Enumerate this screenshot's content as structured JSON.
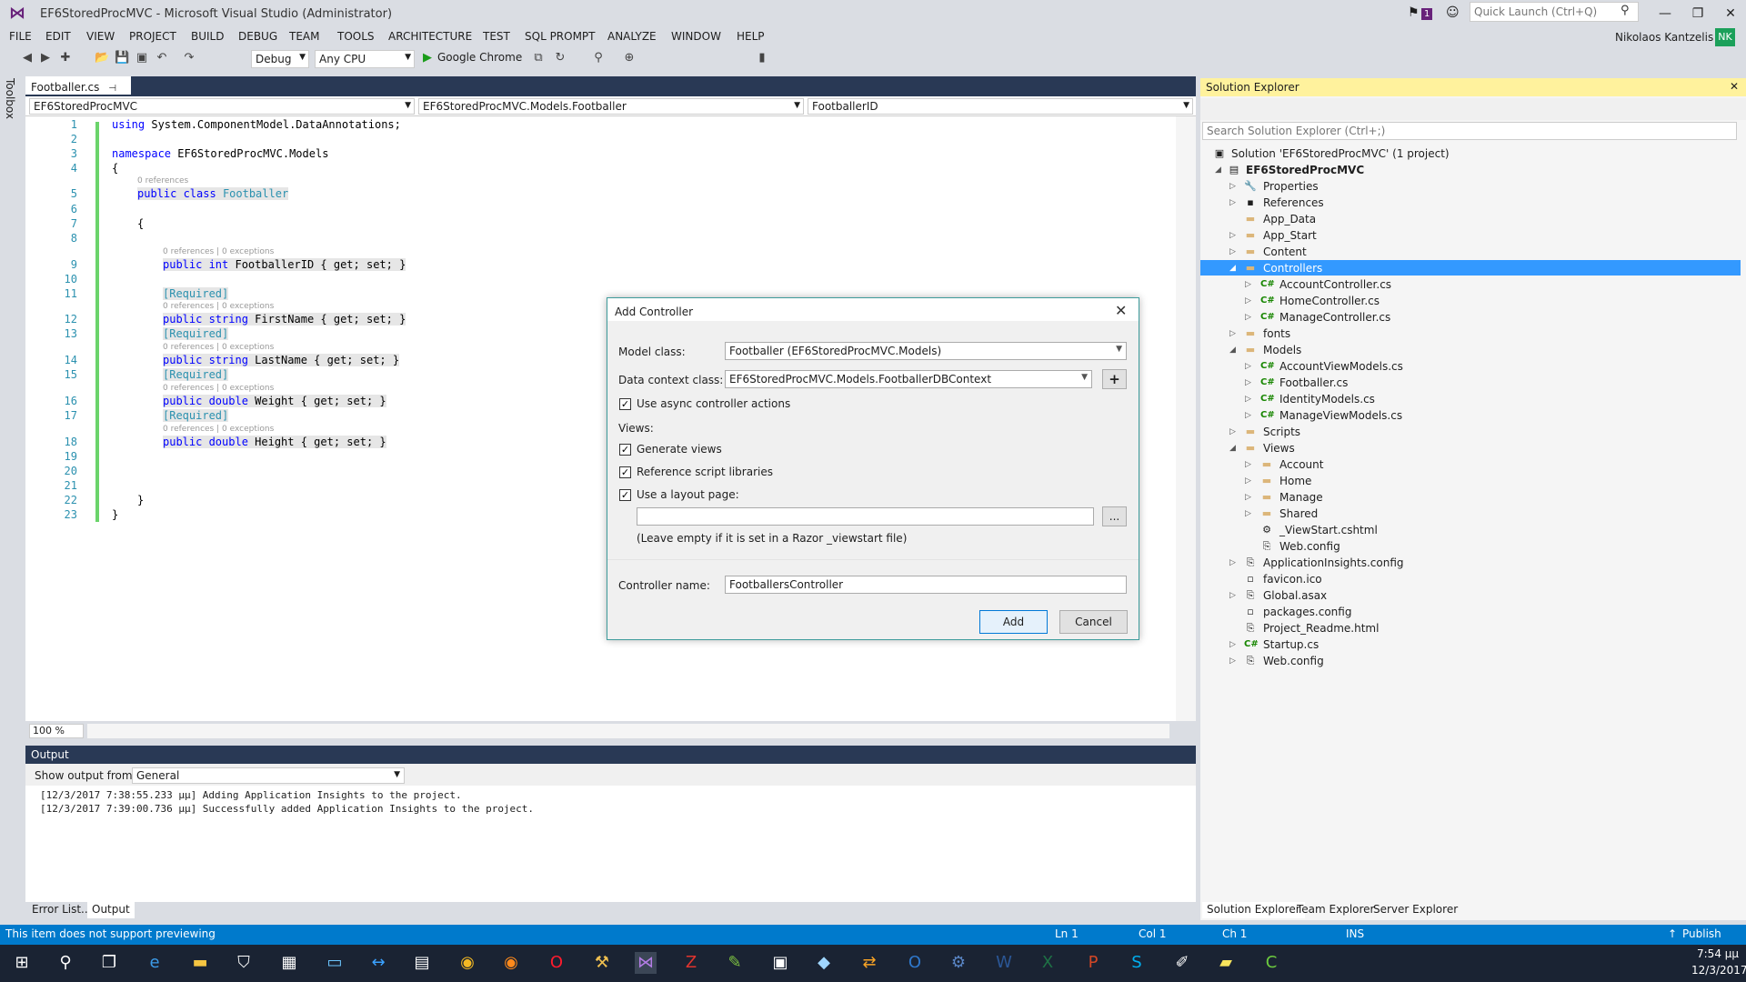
{
  "window": {
    "title": "EF6StoredProcMVC - Microsoft Visual Studio (Administrator)",
    "notification_count": "1",
    "quick_launch_placeholder": "Quick Launch (Ctrl+Q)",
    "user": "Nikolaos Kantzelis",
    "user_initials": "NK"
  },
  "menu": [
    "FILE",
    "EDIT",
    "VIEW",
    "PROJECT",
    "BUILD",
    "DEBUG",
    "TEAM",
    "TOOLS",
    "ARCHITECTURE",
    "TEST",
    "SQL PROMPT",
    "ANALYZE",
    "WINDOW",
    "HELP"
  ],
  "toolbar": {
    "config": "Debug",
    "platform": "Any CPU",
    "browser": "Google Chrome"
  },
  "toolbox": {
    "label": "Toolbox"
  },
  "editor": {
    "tab": "Footballer.cs",
    "nav_project": "EF6StoredProcMVC",
    "nav_class": "EF6StoredProcMVC.Models.Footballer",
    "nav_member": "FootballerID",
    "zoom": "100 %",
    "line_numbers": [
      "1",
      "2",
      "3",
      "4",
      "5",
      "6",
      "7",
      "8",
      "9",
      "10",
      "11",
      "12",
      "13",
      "14",
      "15",
      "16",
      "17",
      "18",
      "19",
      "20",
      "21",
      "22",
      "23"
    ],
    "lens_refs": "0 references",
    "lens_refs_ex": "0 references | 0 exceptions",
    "code": {
      "l1_kw": "using",
      "l1_rest": " System.ComponentModel.DataAnnotations;",
      "l3_kw": "namespace",
      "l3_rest": " EF6StoredProcMVC.Models",
      "brace_open": "{",
      "brace_close": "}",
      "l5_kw": "public class",
      "l5_type": "Footballer",
      "l9_kw": "public int",
      "l9_rest": " FootballerID { get; set; }",
      "required": "[Required]",
      "l12_kw": "public string",
      "l12_rest": " FirstName { get; set; }",
      "l14_kw": "public string",
      "l14_rest": " LastName { get; set; }",
      "l16_kw": "public double",
      "l16_rest": " Weight { get; set; }",
      "l18_kw": "public double",
      "l18_rest": " Height { get; set; }"
    }
  },
  "output": {
    "title": "Output",
    "show_from_label": "Show output from:",
    "source": "General",
    "lines": [
      "[12/3/2017 7:38:55.233 μμ] Adding Application Insights to the project.",
      "[12/3/2017 7:39:00.736 μμ] Successfully added Application Insights to the project."
    ],
    "tabs": [
      "Error List...",
      "Output"
    ]
  },
  "solution_explorer": {
    "title": "Solution Explorer",
    "search_placeholder": "Search Solution Explorer (Ctrl+;)",
    "items": [
      "Solution 'EF6StoredProcMVC' (1 project)",
      "EF6StoredProcMVC",
      "Properties",
      "References",
      "App_Data",
      "App_Start",
      "Content",
      "Controllers",
      "AccountController.cs",
      "HomeController.cs",
      "ManageController.cs",
      "fonts",
      "Models",
      "AccountViewModels.cs",
      "Footballer.cs",
      "IdentityModels.cs",
      "ManageViewModels.cs",
      "Scripts",
      "Views",
      "Account",
      "Home",
      "Manage",
      "Shared",
      "_ViewStart.cshtml",
      "Web.config",
      "ApplicationInsights.config",
      "favicon.ico",
      "Global.asax",
      "packages.config",
      "Project_Readme.html",
      "Startup.cs",
      "Web.config"
    ],
    "tabs": [
      "Solution Explorer",
      "Team Explorer",
      "Server Explorer"
    ]
  },
  "dialog": {
    "title": "Add Controller",
    "model_class_label": "Model class:",
    "model_class": "Footballer (EF6StoredProcMVC.Models)",
    "data_context_label": "Data context class:",
    "data_context": "EF6StoredProcMVC.Models.FootballerDBContext",
    "add_context_btn": "+",
    "async_label": "Use async controller actions",
    "views_label": "Views:",
    "generate_views": "Generate views",
    "ref_scripts": "Reference script libraries",
    "use_layout": "Use a layout page:",
    "layout_value": "",
    "browse_btn": "...",
    "layout_hint": "(Leave empty if it is set in a Razor _viewstart file)",
    "controller_name_label": "Controller name:",
    "controller_name": "FootballersController",
    "add_btn": "Add",
    "cancel_btn": "Cancel"
  },
  "status": {
    "message": "This item does not support previewing",
    "ln": "Ln 1",
    "col": "Col 1",
    "ch": "Ch 1",
    "mode": "INS",
    "publish": "Publish"
  },
  "taskbar": {
    "time": "7:54 μμ",
    "date": "12/3/2017"
  }
}
